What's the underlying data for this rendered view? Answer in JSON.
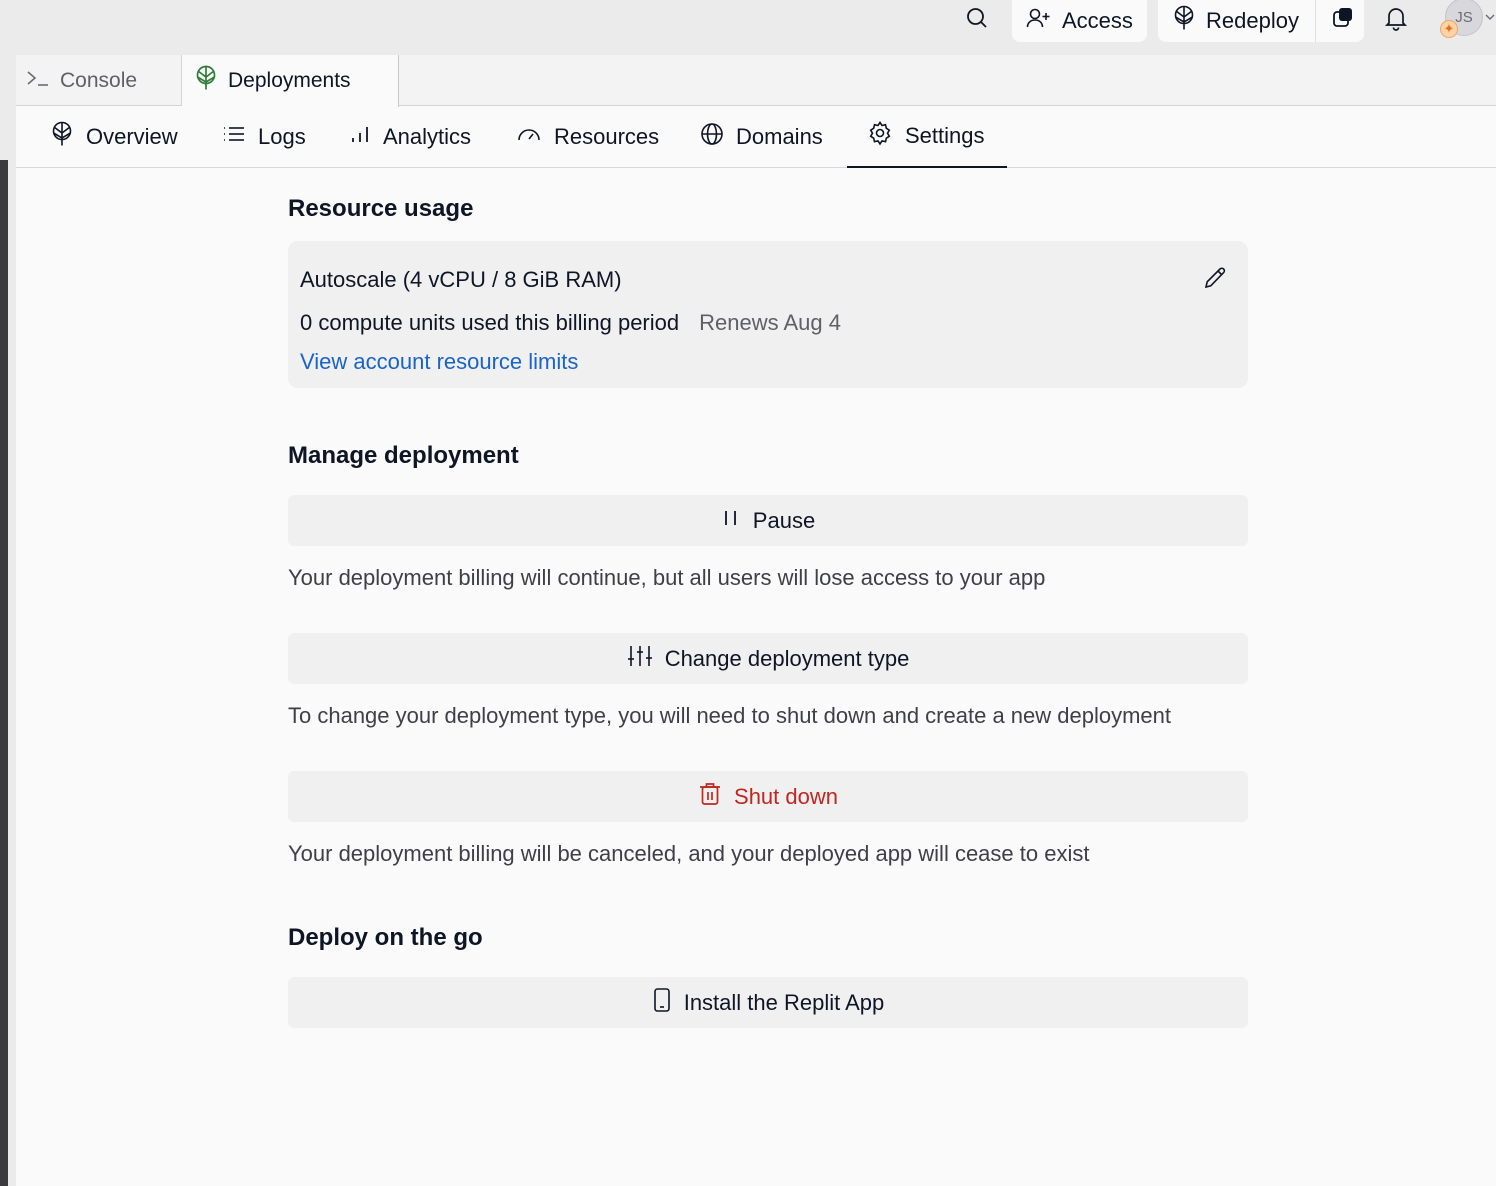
{
  "topbar": {
    "access_label": "Access",
    "redeploy_label": "Redeploy",
    "avatar_initials": "JS"
  },
  "file_tabs": {
    "console": "Console",
    "deployments": "Deployments"
  },
  "subnav": {
    "overview": "Overview",
    "logs": "Logs",
    "analytics": "Analytics",
    "resources": "Resources",
    "domains": "Domains",
    "settings": "Settings",
    "active": "Settings"
  },
  "resource_usage": {
    "heading": "Resource usage",
    "plan": "Autoscale (4 vCPU / 8 GiB RAM)",
    "usage": "0 compute units used this billing period",
    "renews": "Renews Aug 4",
    "limits_link": "View account resource limits"
  },
  "manage": {
    "heading": "Manage deployment",
    "pause_label": "Pause",
    "pause_desc": "Your deployment billing will continue, but all users will lose access to your app",
    "change_label": "Change deployment type",
    "change_desc": "To change your deployment type, you will need to shut down and create a new deployment",
    "shutdown_label": "Shut down",
    "shutdown_desc": "Your deployment billing will be canceled, and your deployed app will cease to exist"
  },
  "on_the_go": {
    "heading": "Deploy on the go",
    "install_label": "Install the Replit App"
  },
  "colors": {
    "danger": "#c0271e",
    "link": "#1a63c7",
    "deploy_icon": "#2f7d3a"
  }
}
